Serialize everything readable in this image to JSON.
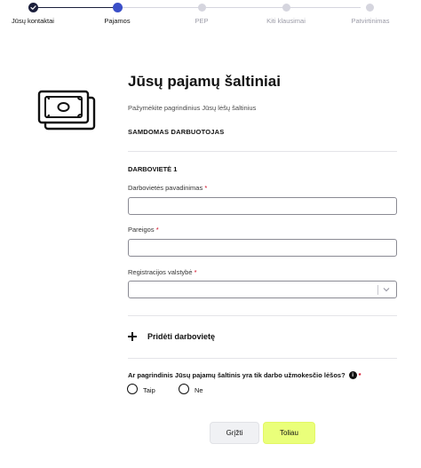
{
  "stepper": {
    "steps": [
      {
        "label": "Jūsų kontaktai",
        "state": "done"
      },
      {
        "label": "Pajamos",
        "state": "active"
      },
      {
        "label": "PEP",
        "state": "pending"
      },
      {
        "label": "Kiti klausimai",
        "state": "pending"
      },
      {
        "label": "Patvirtinimas",
        "state": "pending"
      }
    ],
    "colors": {
      "done": "#1b1f3b",
      "active": "#3b4fc8",
      "pending": "#d5d5de"
    }
  },
  "header": {
    "icon": "money-banknotes-icon",
    "title": "Jūsų pajamų šaltiniai",
    "subtitle": "Pažymėkite pagrindinius Jūsų lėšų šaltinius"
  },
  "section": {
    "title": "SAMDOMAS DARBUOTOJAS"
  },
  "employer": {
    "title": "DARBOVIETĖ 1",
    "name_label": "Darbovietės pavadinimas",
    "name_value": "",
    "position_label": "Pareigos",
    "position_value": "",
    "country_label": "Registracijos valstybė",
    "country_value": "",
    "required_mark": "*"
  },
  "add_employer": {
    "label": "Pridėti darbovietę"
  },
  "question": {
    "text": "Ar pagrindinis Jūsų pajamų šaltinis yra tik darbo užmokesčio lėšos?",
    "info_icon": "i",
    "required_mark": "*",
    "options": [
      {
        "label": "Taip",
        "selected": false
      },
      {
        "label": "Ne",
        "selected": false
      }
    ]
  },
  "buttons": {
    "back": "Grįžti",
    "next": "Toliau"
  },
  "colors": {
    "accent": "#eaff7a",
    "required": "#d0021b"
  }
}
